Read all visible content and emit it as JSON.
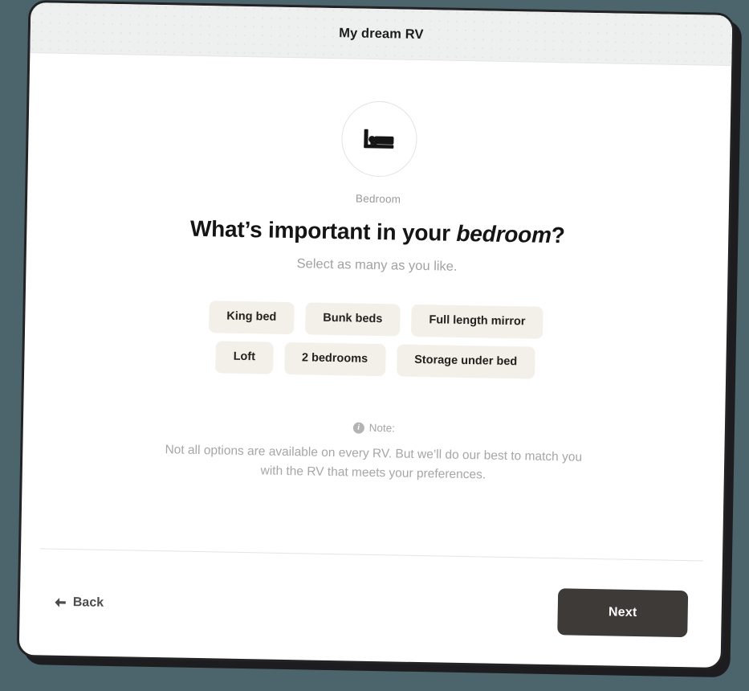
{
  "window": {
    "title": "My dream RV",
    "background_color": "#4c646c",
    "header_color": "#eeefef"
  },
  "hero": {
    "icon": "bed-icon",
    "category_label": "Bedroom"
  },
  "question": {
    "prefix": "What’s important in your ",
    "emphasis": "bedroom",
    "suffix": "?",
    "subtitle": "Select as many as you like."
  },
  "options": {
    "rows": [
      [
        {
          "label": "King bed",
          "selected": false
        },
        {
          "label": "Bunk beds",
          "selected": false
        },
        {
          "label": "Full length mirror",
          "selected": false
        }
      ],
      [
        {
          "label": "Loft",
          "selected": false
        },
        {
          "label": "2 bedrooms",
          "selected": false
        },
        {
          "label": "Storage under bed",
          "selected": false
        }
      ]
    ],
    "chip_color": "#f3f0ea",
    "chip_text_color": "#24211f"
  },
  "note": {
    "icon": "info-icon",
    "icon_glyph": "i",
    "heading": "Note:",
    "body": "Not all options are available on every RV. But we’ll do our best to match you with the RV that meets your preferences."
  },
  "footer": {
    "back_label": "Back",
    "back_icon": "arrow-left-icon",
    "next_label": "Next",
    "next_color": "#3d3a38"
  }
}
